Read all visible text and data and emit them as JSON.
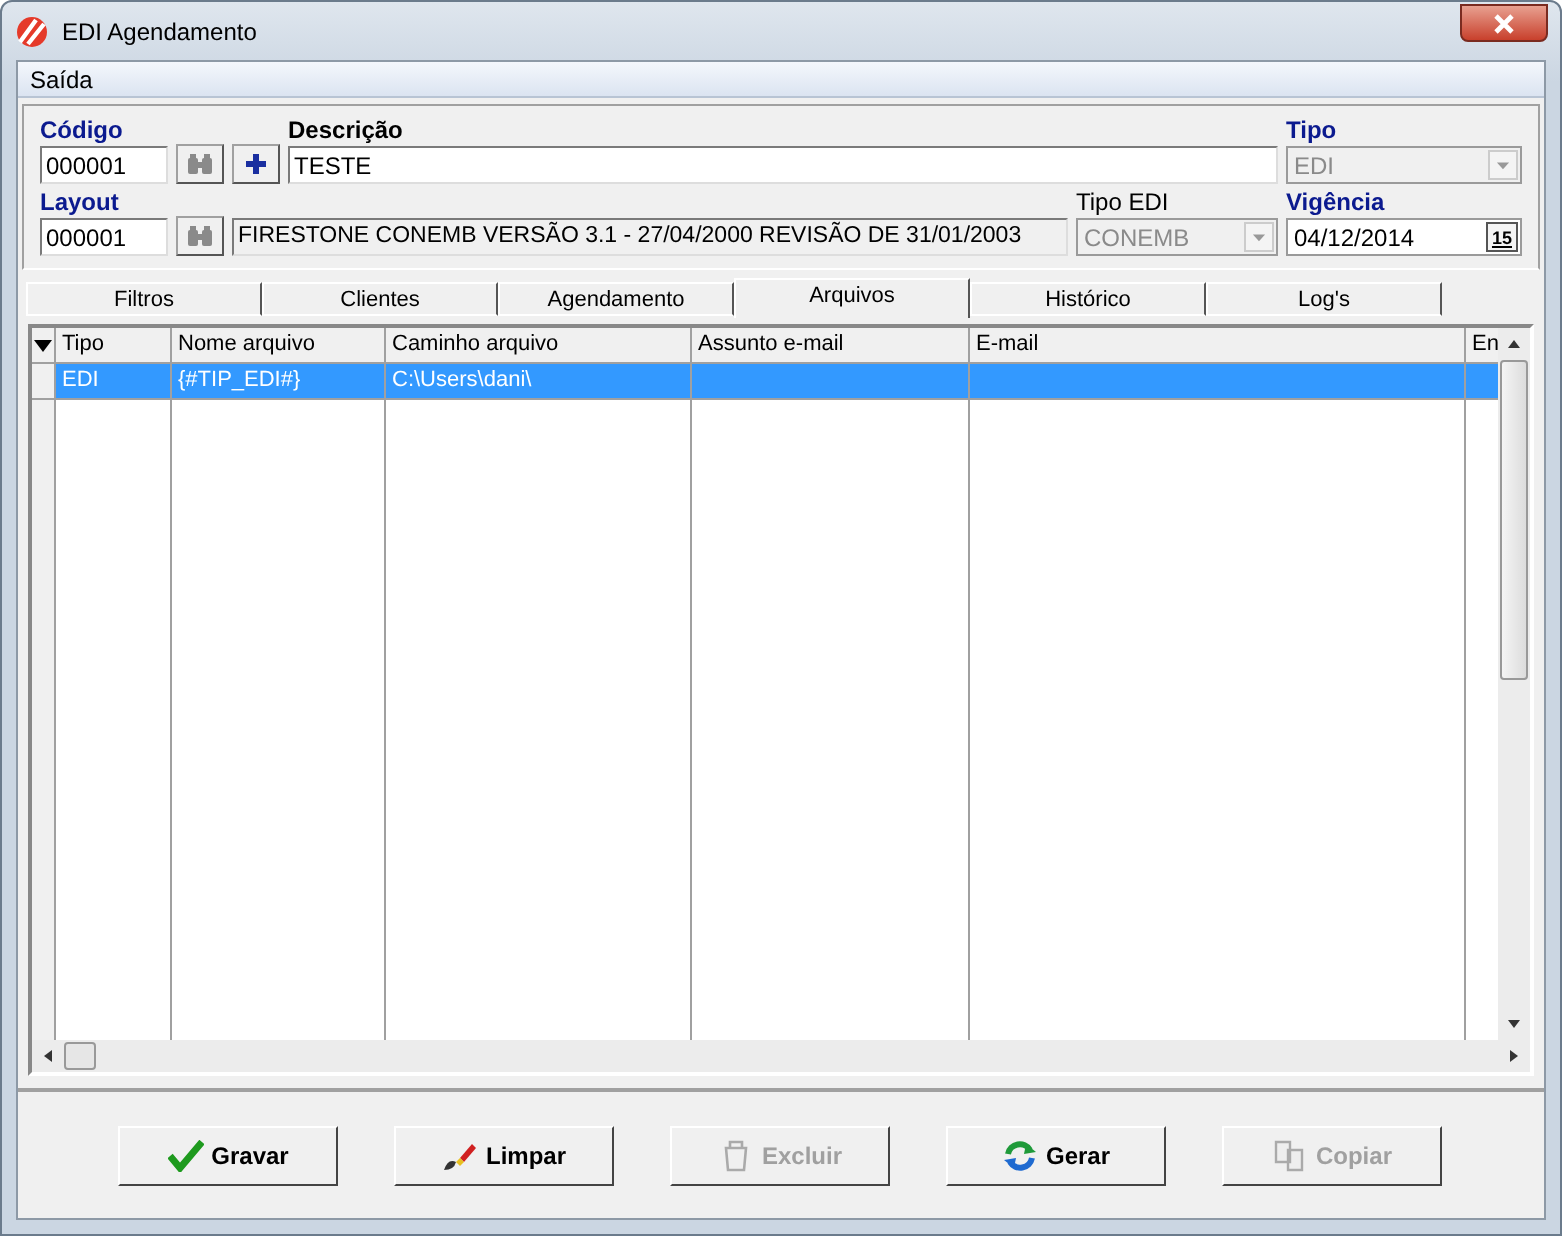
{
  "window": {
    "title": "EDI Agendamento"
  },
  "menu": [
    {
      "label": "Saída"
    }
  ],
  "form": {
    "codigo": {
      "label": "Código",
      "value": "000001"
    },
    "descricao": {
      "label": "Descrição",
      "value": "TESTE"
    },
    "tipo": {
      "label": "Tipo",
      "value": "EDI",
      "disabled": true
    },
    "layout": {
      "label": "Layout",
      "value": "000001",
      "description": "FIRESTONE CONEMB VERSÃO 3.1  - 27/04/2000 REVISÃO DE 31/01/2003"
    },
    "tipo_edi": {
      "label": "Tipo EDI",
      "value": "CONEMB",
      "disabled": true
    },
    "vigencia": {
      "label": "Vigência",
      "value": "04/12/2014",
      "calendar": "15"
    }
  },
  "tabs": [
    {
      "label": "Filtros",
      "selected": false
    },
    {
      "label": "Clientes",
      "selected": false
    },
    {
      "label": "Agendamento",
      "selected": false
    },
    {
      "label": "Arquivos",
      "selected": true
    },
    {
      "label": "Histórico",
      "selected": false
    },
    {
      "label": "Log's",
      "selected": false
    }
  ],
  "table": {
    "columns": [
      "Tipo",
      "Nome arquivo",
      "Caminho arquivo",
      "Assunto e-mail",
      "E-mail",
      "En"
    ],
    "rows": [
      {
        "cells": [
          "EDI",
          "{#TIP_EDI#}",
          "C:\\Users\\dani\\",
          "",
          "",
          ""
        ],
        "selected": true
      }
    ]
  },
  "buttons": [
    {
      "label": "Gravar",
      "kind": "save",
      "disabled": false
    },
    {
      "label": "Limpar",
      "kind": "clear",
      "disabled": false
    },
    {
      "label": "Excluir",
      "kind": "delete",
      "disabled": true
    },
    {
      "label": "Gerar",
      "kind": "generate",
      "disabled": false
    },
    {
      "label": "Copiar",
      "kind": "copy",
      "disabled": true
    }
  ]
}
